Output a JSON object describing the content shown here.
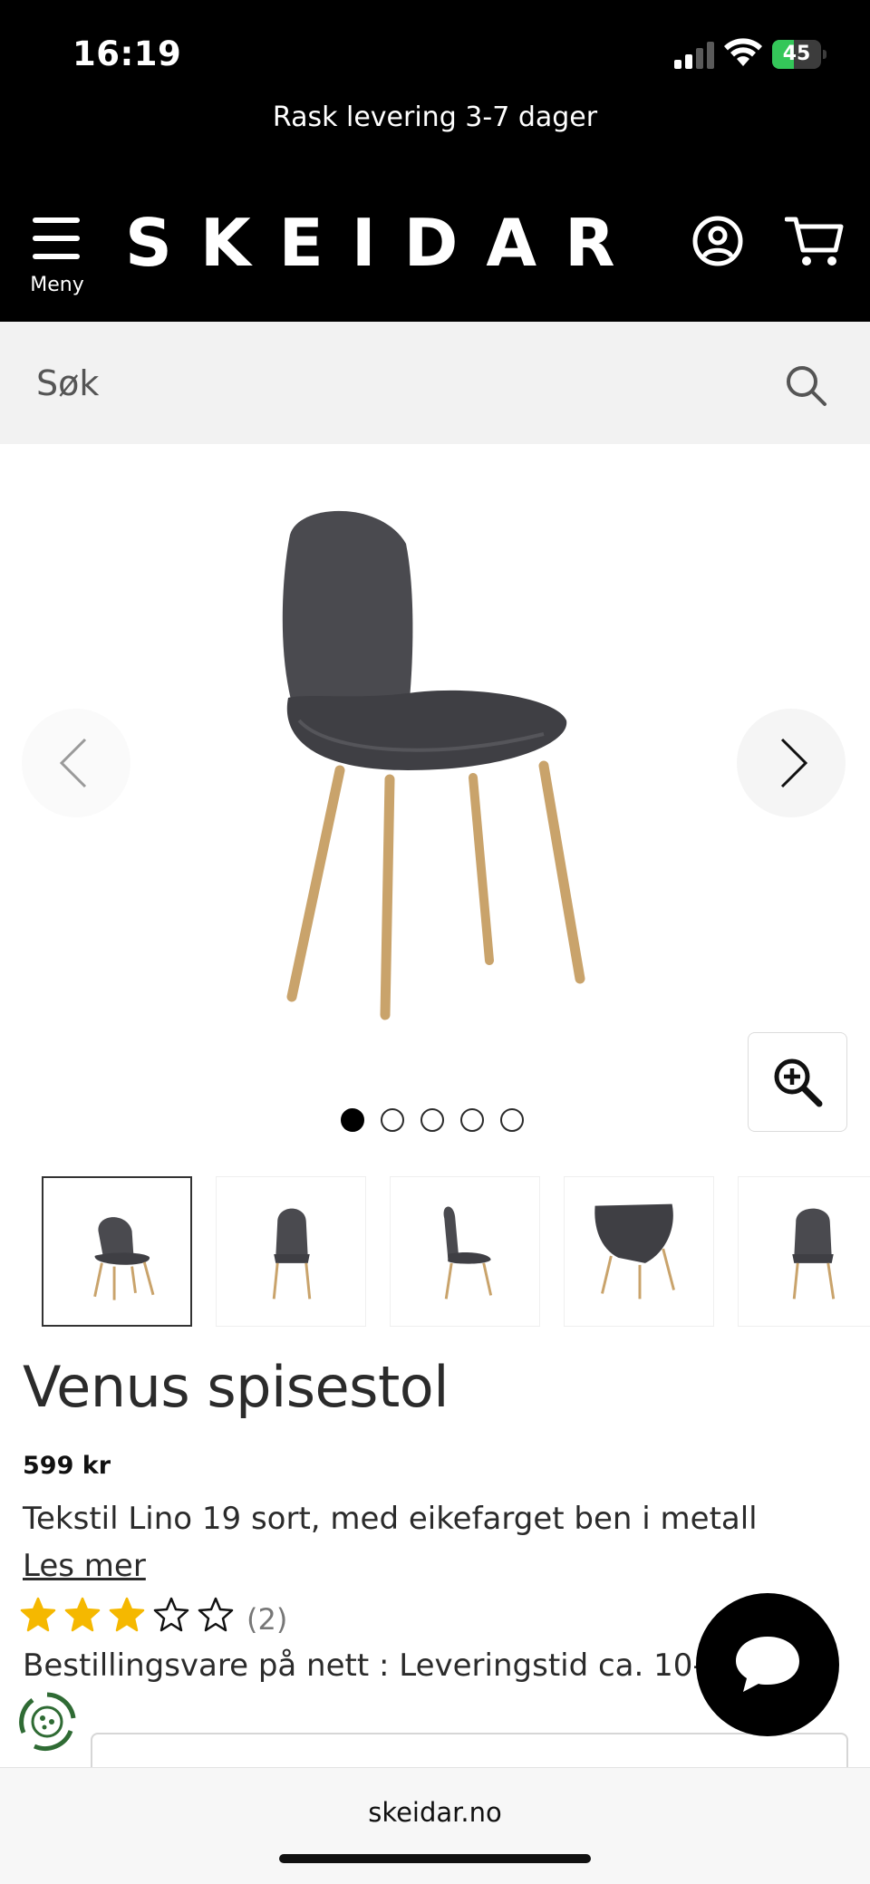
{
  "status_bar": {
    "time": "16:19",
    "battery_level": "45",
    "battery_percent": 45,
    "icons": [
      "signal-icon",
      "wifi-icon",
      "battery-icon"
    ]
  },
  "promo": {
    "text": "Rask levering 3-7 dager"
  },
  "header": {
    "menu_label": "Meny",
    "logo_text": "SKEIDAR",
    "icons": [
      "menu-icon",
      "account-icon",
      "cart-icon"
    ]
  },
  "search": {
    "placeholder": "Søk",
    "icon": "search-icon"
  },
  "gallery": {
    "slide_count": 5,
    "active_slide": 1,
    "icons": [
      "chevron-left-icon",
      "chevron-right-icon",
      "zoom-in-icon"
    ],
    "thumbnail_count": 5,
    "selected_thumbnail": 1
  },
  "product": {
    "title": "Venus spisestol",
    "price": "599 kr",
    "description": "Tekstil Lino 19 sort, med eikefarget ben i metall",
    "read_more": "Les mer",
    "rating": 3,
    "rating_max": 5,
    "review_count": "(2)",
    "availability": "Bestillingsvare på nett : Leveringstid ca. 10-11 uker"
  },
  "floating": {
    "icons": [
      "chat-icon",
      "eco-badge-icon"
    ]
  },
  "browser": {
    "url": "skeidar.no"
  },
  "colors": {
    "header_bg": "#000000",
    "search_bg": "#f2f2f2",
    "star_filled": "#f5b800",
    "battery_green": "#34c759",
    "text": "#2b2b2b"
  }
}
